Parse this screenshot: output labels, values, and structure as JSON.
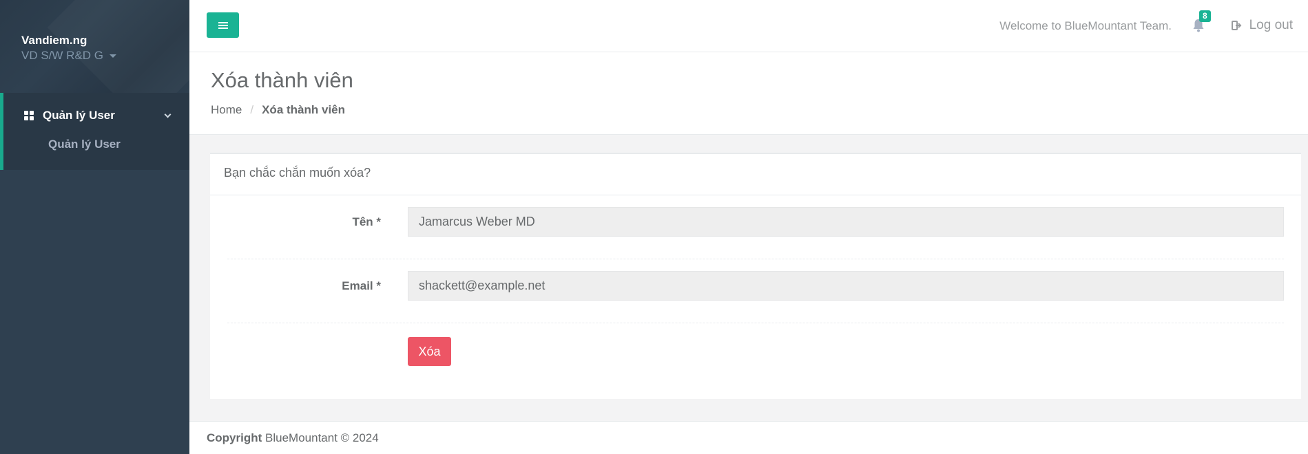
{
  "sidebar": {
    "profile_name": "Vandiem.ng",
    "profile_role": "VD S/W R&D G",
    "nav_section_label": "Quản lý User",
    "nav_sub_item_label": "Quản lý User"
  },
  "topbar": {
    "welcome_text": "Welcome to BlueMountant Team.",
    "notification_count": "8",
    "logout_label": "Log out",
    "accent_color": "#1ab394"
  },
  "heading": {
    "title": "Xóa thành viên",
    "breadcrumb_home": "Home",
    "breadcrumb_sep": "/",
    "breadcrumb_current": "Xóa thành viên"
  },
  "form": {
    "title": "Bạn chắc chắn muốn xóa?",
    "name_label": "Tên *",
    "name_value": "Jamarcus Weber MD",
    "email_label": "Email *",
    "email_value": "shackett@example.net",
    "delete_label": "Xóa",
    "delete_color": "#ed5565"
  },
  "footer": {
    "copyright_label": "Copyright",
    "copyright_text": "BlueMountant © 2024"
  },
  "icons": [
    "menu-icon",
    "bell-icon",
    "logout-icon",
    "dashboard-grid-icon",
    "chevron-down-icon",
    "caret-down-icon"
  ]
}
